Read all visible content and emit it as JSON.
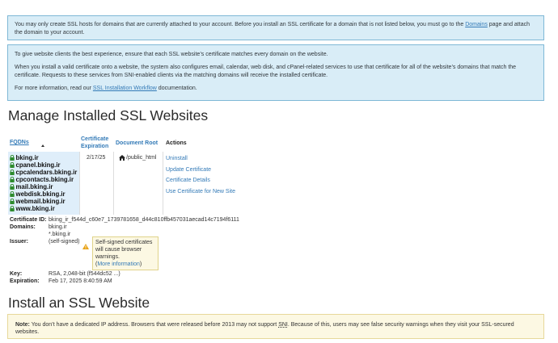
{
  "alerts": {
    "box1_text": "You may only create SSL hosts for domains that are currently attached to your account. Before you install an SSL certificate for a domain that is not listed below, you must go to the ",
    "box1_link": "Domains",
    "box1_text_after": " page and attach the domain to your account.",
    "box2_p1": "To give website clients the best experience, ensure that each SSL website’s certificate matches every domain on the website.",
    "box2_p2": "When you install a valid certificate onto a website, the system also configures email, calendar, web disk, and cPanel-related services to use that certificate for all of the website’s domains that match the certificate. Requests to these services from SNI-enabled clients via the matching domains will receive the installed certificate.",
    "box2_p3_before": "For more information, read our ",
    "box2_p3_link": "SSL Installation Workflow",
    "box2_p3_after": " documentation."
  },
  "manage": {
    "title": "Manage Installed SSL Websites",
    "headers": {
      "fqdns": "FQDNs",
      "cert_exp_line1": "Certificate",
      "cert_exp_line2": "Expiration",
      "doc_root": "Document Root",
      "actions": "Actions"
    },
    "fqdns": [
      "bking.ir",
      "cpanel.bking.ir",
      "cpcalendars.bking.ir",
      "cpcontacts.bking.ir",
      "mail.bking.ir",
      "webdisk.bking.ir",
      "webmail.bking.ir",
      "www.bking.ir"
    ],
    "expiration": "2/17/25",
    "doc_root": "/public_html",
    "actions": [
      "Uninstall",
      "Update Certificate",
      "Certificate Details",
      "Use Certificate for New Site"
    ],
    "details": {
      "cert_id_label": "Certificate ID:",
      "cert_id": "bking_ir_f544d_c60e7_1739781658_d44c810ffb457031aecad14c7194f6111",
      "domains_label": "Domains:",
      "domains": [
        "bking.ir",
        "*.bking.ir"
      ],
      "issuer_label": "Issuer:",
      "issuer": "(self-signed)",
      "tooltip_text": "Self-signed certificates will cause browser warnings.",
      "tooltip_link": "More information",
      "key_label": "Key:",
      "key": "RSA, 2,048-bit (f544dc52 ...)",
      "expiration_label": "Expiration:",
      "expiration": "Feb 17, 2025 8:40:59 AM"
    }
  },
  "install": {
    "title": "Install an SSL Website",
    "note_label": "Note:",
    "note_before": " You don’t have a dedicated IP address. Browsers that were released before 2013 may not support ",
    "note_sni": "SNI",
    "note_after": ". Because of this, users may see false security warnings when they visit your SSL-secured websites."
  },
  "colors": {
    "info_bg": "#d9edf7",
    "info_border": "#7fb8d6",
    "link": "#337ab7",
    "lock_green": "#2e8b2e",
    "warning_bg": "#fcf8e3"
  }
}
